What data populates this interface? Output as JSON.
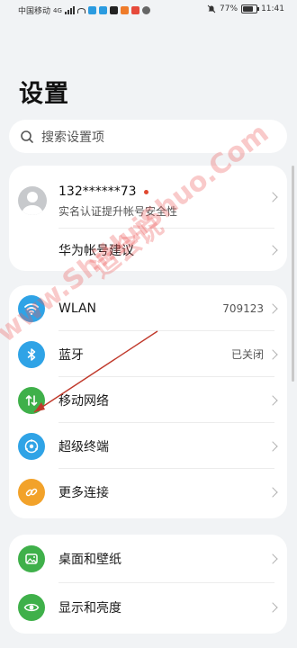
{
  "status_bar": {
    "carrier": "中国移动",
    "network": "4G",
    "battery": "77%",
    "time": "11:41"
  },
  "title": "设置",
  "search": {
    "placeholder": "搜索设置项"
  },
  "account": {
    "phone": "132******73",
    "subtitle": "实名认证提升帐号安全性",
    "suggestion_label": "华为帐号建议"
  },
  "network_items": [
    {
      "label": "WLAN",
      "value": "709123",
      "icon": "wifi-icon",
      "color": "#2fa3e6"
    },
    {
      "label": "蓝牙",
      "value": "已关闭",
      "icon": "bluetooth-icon",
      "color": "#2fa3e6"
    },
    {
      "label": "移动网络",
      "value": "",
      "icon": "mobile-network-icon",
      "color": "#3fb04a"
    },
    {
      "label": "超级终端",
      "value": "",
      "icon": "super-device-icon",
      "color": "#2fa3e6"
    },
    {
      "label": "更多连接",
      "value": "",
      "icon": "link-icon",
      "color": "#f2a22a"
    }
  ],
  "display_items": [
    {
      "label": "桌面和壁纸",
      "icon": "wallpaper-icon",
      "color": "#3fb04a"
    },
    {
      "label": "显示和亮度",
      "icon": "eye-icon",
      "color": "#3fb04a"
    }
  ],
  "watermark": {
    "text_cn": "适会说",
    "text_en": "www.ShiHuiShuo.Com"
  }
}
